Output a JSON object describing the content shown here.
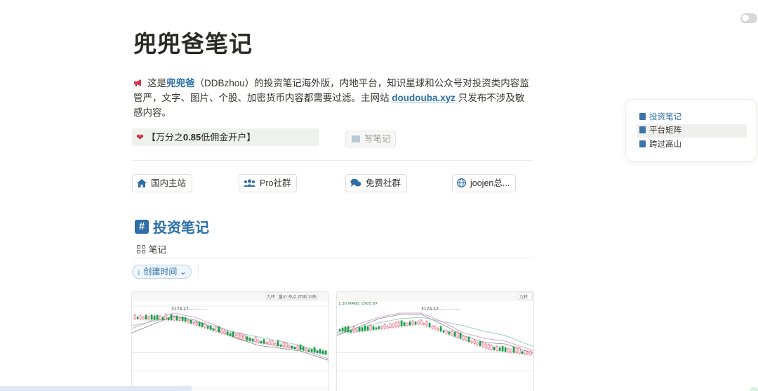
{
  "page": {
    "title": "兜兜爸笔记"
  },
  "intro": {
    "prefix": "这是",
    "brand": "兜兜爸",
    "middle": "（DDBzhou）的投资笔记海外版，内地平台，知识星球和公众号对投资类内容监管严，文字、图片、个股、加密货币内容都需要过滤。主网站 ",
    "site_link": "doudouba.xyz",
    "suffix": " 只发布不涉及敏感内容。"
  },
  "promo": {
    "open": "【万分之",
    "rate": "0.85",
    "close": "低佣金开户】"
  },
  "write_button": {
    "label": "写笔记"
  },
  "nav_buttons": [
    {
      "label": "国内主站",
      "icon": "home-icon"
    },
    {
      "label": "Pro社群",
      "icon": "group-icon"
    },
    {
      "label": "免费社群",
      "icon": "chat-icon"
    },
    {
      "label": "joojen总...",
      "icon": "globe-icon"
    }
  ],
  "section": {
    "title": "投资笔记",
    "hash": "#"
  },
  "view": {
    "tab_label": "笔记"
  },
  "sort": {
    "label": "↓ 创建时间",
    "caret": "⌄"
  },
  "cards": [
    {
      "high_label": "3174.27",
      "toolbar_labels": [
        "九转",
        "量价",
        "热点",
        "回测",
        "训练"
      ]
    },
    {
      "high_label": "3174.27",
      "ma_label": "1.30 MA60: 2905.97",
      "toolbar_labels": [
        "九转"
      ]
    }
  ],
  "toc": {
    "items": [
      {
        "label": "投资笔记",
        "state": "active"
      },
      {
        "label": "平台矩阵",
        "state": "hover"
      },
      {
        "label": "跨过高山",
        "state": "normal"
      }
    ]
  },
  "colors": {
    "accent": "#2a6fa8",
    "promo_bg": "#edf3ec",
    "candle_up": "#e04c6b",
    "candle_down": "#1f9e4a"
  }
}
